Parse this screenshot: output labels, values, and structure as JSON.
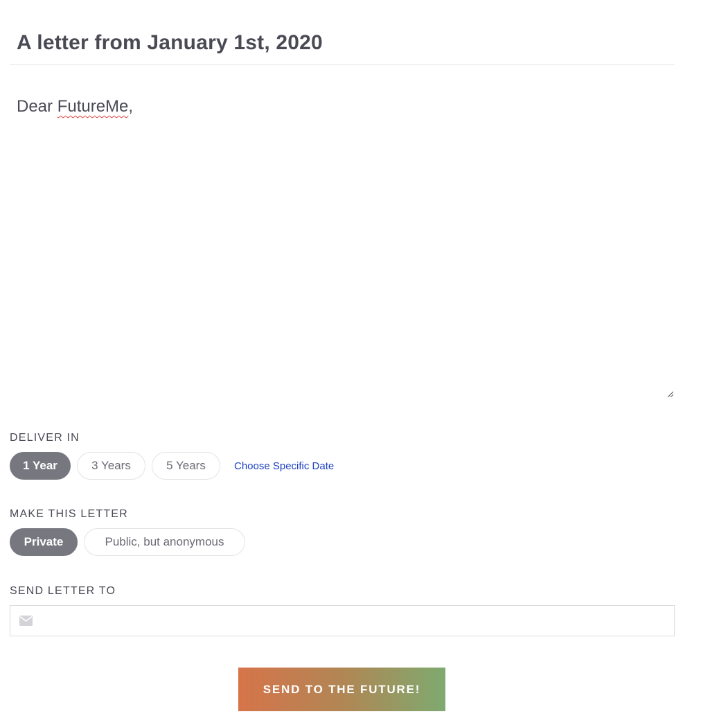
{
  "letter": {
    "title": "A letter from January 1st, 2020",
    "greeting_prefix": "Dear ",
    "greeting_name": "FutureMe",
    "greeting_suffix": ","
  },
  "deliver": {
    "label": "DELIVER IN",
    "options": [
      "1 Year",
      "3 Years",
      "5 Years"
    ],
    "selected": "1 Year",
    "specific_date_link": "Choose Specific Date"
  },
  "visibility": {
    "label": "MAKE THIS LETTER",
    "options": [
      "Private",
      "Public, but anonymous"
    ],
    "selected": "Private"
  },
  "recipient": {
    "label": "SEND LETTER TO",
    "email_value": "",
    "icon": "envelope-icon"
  },
  "submit": {
    "label": "SEND TO THE FUTURE!"
  },
  "colors": {
    "text": "#4a4a55",
    "pill_active_bg": "#777780",
    "link": "#1a3fc4",
    "button_gradient_start": "#d6744a",
    "button_gradient_end": "#7eaa70"
  }
}
